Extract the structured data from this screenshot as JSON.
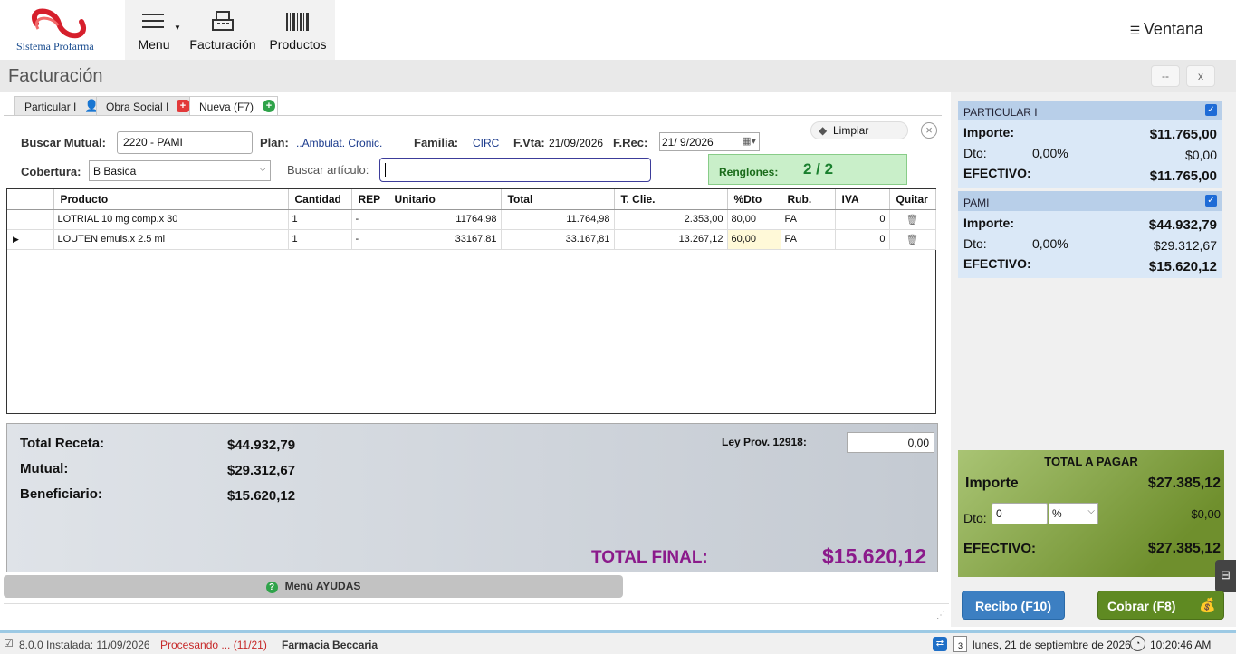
{
  "app": {
    "logo_text": "Sistema Profarma",
    "ventana_label": "Ventana",
    "window_title": "Facturación",
    "minimize_label": "--",
    "close_label": "x"
  },
  "toolbar": {
    "menu_label": "Menu",
    "facturacion_label": "Facturación",
    "productos_label": "Productos"
  },
  "tabs": [
    {
      "label": "Particular I"
    },
    {
      "label": "Obra Social I"
    },
    {
      "label": "Nueva (F7)"
    }
  ],
  "form": {
    "buscar_mutual_label": "Buscar Mutual:",
    "buscar_mutual_value": "2220 - PAMI",
    "plan_label": "Plan:",
    "plan_value": "..Ambulat. Cronic.",
    "familia_label": "Familia:",
    "familia_value": "CIRC",
    "fvta_label": "F.Vta:",
    "fvta_value": "21/09/2026",
    "frec_label": "F.Rec:",
    "frec_value": "21/  9/2026",
    "limpiar_label": "Limpiar",
    "cobertura_label": "Cobertura:",
    "cobertura_value": "B Basica",
    "buscar_articulo_label": "Buscar artículo:",
    "buscar_articulo_value": "",
    "renglones_label": "Renglones:",
    "renglones_value": "2 / 2"
  },
  "grid": {
    "columns": [
      "Producto",
      "Cantidad",
      "REP",
      "Unitario",
      "Total",
      "T. Clie.",
      "%Dto",
      "Rub.",
      "IVA",
      "Quitar"
    ],
    "rows": [
      {
        "producto": "LOTRIAL 10 mg comp.x 30",
        "cantidad": "1",
        "rep": "-",
        "unitario": "11764.98",
        "total": "11.764,98",
        "tclie": "2.353,00",
        "dto": "80,00",
        "rub": "FA",
        "iva": "0"
      },
      {
        "producto": "LOUTEN emuls.x 2.5 ml",
        "cantidad": "1",
        "rep": "-",
        "unitario": "33167.81",
        "total": "33.167,81",
        "tclie": "13.267,12",
        "dto": "60,00",
        "rub": "FA",
        "iva": "0"
      }
    ]
  },
  "totals": {
    "total_receta_label": "Total Receta:",
    "total_receta_value": "$44.932,79",
    "mutual_label": "Mutual:",
    "mutual_value": "$29.312,67",
    "beneficiario_label": "Beneficiario:",
    "beneficiario_value": "$15.620,12",
    "ley_label": "Ley Prov. 12918:",
    "ley_value": "0,00",
    "total_final_label": "TOTAL FINAL:",
    "total_final_value": "$15.620,12"
  },
  "menu_ayudas_label": "Menú AYUDAS",
  "cards": [
    {
      "title": "PARTICULAR I",
      "importe_label": "Importe:",
      "importe": "$11.765,00",
      "dto_label": "Dto:",
      "dto_pct": "0,00%",
      "dto_value": "$0,00",
      "efectivo_label": "EFECTIVO:",
      "efectivo": "$11.765,00"
    },
    {
      "title": "PAMI",
      "importe_label": "Importe:",
      "importe": "$44.932,79",
      "dto_label": "Dto:",
      "dto_pct": "0,00%",
      "dto_value": "$29.312,67",
      "efectivo_label": "EFECTIVO:",
      "efectivo": "$15.620,12"
    }
  ],
  "total_a_pagar": {
    "title": "TOTAL A PAGAR",
    "importe_label": "Importe",
    "importe": "$27.385,12",
    "dto_label": "Dto:",
    "dto_input": "0",
    "dto_unit": "%",
    "dto_value": "$0,00",
    "efectivo_label": "EFECTIVO:",
    "efectivo": "$27.385,12"
  },
  "buttons": {
    "recibo": "Recibo (F10)",
    "cobrar": "Cobrar (F8)"
  },
  "status": {
    "version": "8.0.0 Instalada: 11/09/2026",
    "procesando": "Procesando ... (11/21)",
    "farmacia": "Farmacia Beccaria",
    "date": "lunes, 21 de septiembre de 2026",
    "time": "10:20:46 AM",
    "calendar_day": "3"
  },
  "colors": {
    "accent_green": "#1a7f2e",
    "total_final": "#8b1a8b",
    "recibo_btn": "#3c7fc2",
    "cobrar_btn": "#5f8a22"
  }
}
